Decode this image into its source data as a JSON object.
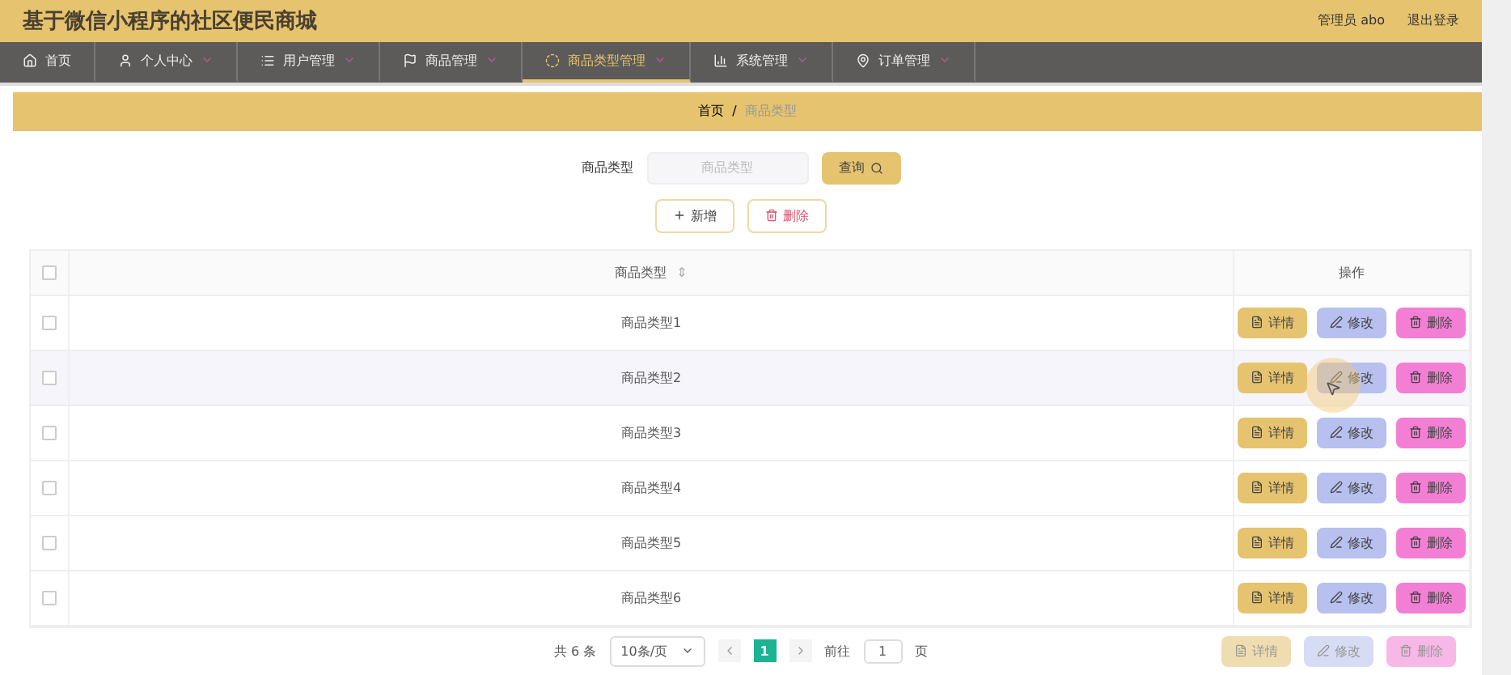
{
  "header": {
    "title": "基于微信小程序的社区便民商城",
    "user": "管理员 abo",
    "logout": "退出登录"
  },
  "nav": [
    {
      "label": "首页",
      "selected": false,
      "dropdown": false
    },
    {
      "label": "个人中心",
      "selected": false,
      "dropdown": true
    },
    {
      "label": "用户管理",
      "selected": false,
      "dropdown": true
    },
    {
      "label": "商品管理",
      "selected": false,
      "dropdown": true
    },
    {
      "label": "商品类型管理",
      "selected": true,
      "dropdown": true
    },
    {
      "label": "系统管理",
      "selected": false,
      "dropdown": true
    },
    {
      "label": "订单管理",
      "selected": false,
      "dropdown": true
    }
  ],
  "breadcrumb": {
    "home": "首页",
    "separator": "/",
    "current": "商品类型"
  },
  "search": {
    "label": "商品类型",
    "placeholder": "商品类型",
    "button": "查询"
  },
  "actions": {
    "add": "新增",
    "delete": "删除"
  },
  "table": {
    "all_checked": false,
    "columns": [
      "商品类型",
      "操作"
    ],
    "sort_mark": "⇕",
    "rows": [
      {
        "type": "商品类型1",
        "checked": false,
        "hover": false,
        "buttons": [
          "详情",
          "修改",
          "删除"
        ]
      },
      {
        "type": "商品类型2",
        "checked": false,
        "hover": true,
        "buttons": [
          "详情",
          "修改",
          "删除"
        ]
      },
      {
        "type": "商品类型3",
        "checked": false,
        "hover": false,
        "buttons": [
          "详情",
          "修改",
          "删除"
        ]
      },
      {
        "type": "商品类型4",
        "checked": false,
        "hover": false,
        "buttons": [
          "详情",
          "修改",
          "删除"
        ]
      },
      {
        "type": "商品类型5",
        "checked": false,
        "hover": false,
        "buttons": [
          "详情",
          "修改",
          "删除"
        ]
      },
      {
        "type": "商品类型6",
        "checked": false,
        "hover": false,
        "buttons": [
          "详情",
          "修改",
          "删除"
        ]
      }
    ]
  },
  "pagination": {
    "total": "共 6 条",
    "page_size": "10条/页",
    "pages": [
      {
        "label": "1",
        "selected": true
      }
    ],
    "goto_label": "前往",
    "goto_value": "1",
    "goto_suffix": "页"
  },
  "ghost_buttons": [
    "详情",
    "修改",
    "删除"
  ]
}
